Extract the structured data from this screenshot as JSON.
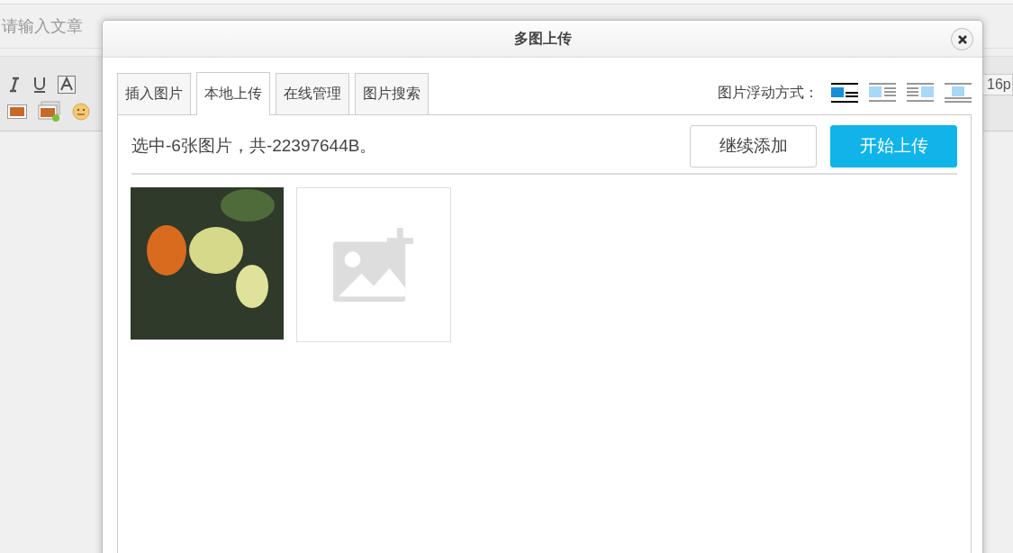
{
  "editor": {
    "title_placeholder": "请输入文章",
    "font_size": "16p"
  },
  "dialog": {
    "title": "多图上传",
    "tabs": [
      {
        "label": "插入图片",
        "selected": false
      },
      {
        "label": "本地上传",
        "selected": true
      },
      {
        "label": "在线管理",
        "selected": false
      },
      {
        "label": "图片搜索",
        "selected": false
      }
    ],
    "float_label": "图片浮动方式：",
    "float_modes": [
      {
        "kind": "none",
        "selected": true
      },
      {
        "kind": "left",
        "selected": false
      },
      {
        "kind": "right",
        "selected": false
      },
      {
        "kind": "center",
        "selected": false
      }
    ],
    "status": "选中-6张图片，共-22397644B。",
    "buttons": {
      "add": "继续添加",
      "upload": "开始上传"
    }
  }
}
